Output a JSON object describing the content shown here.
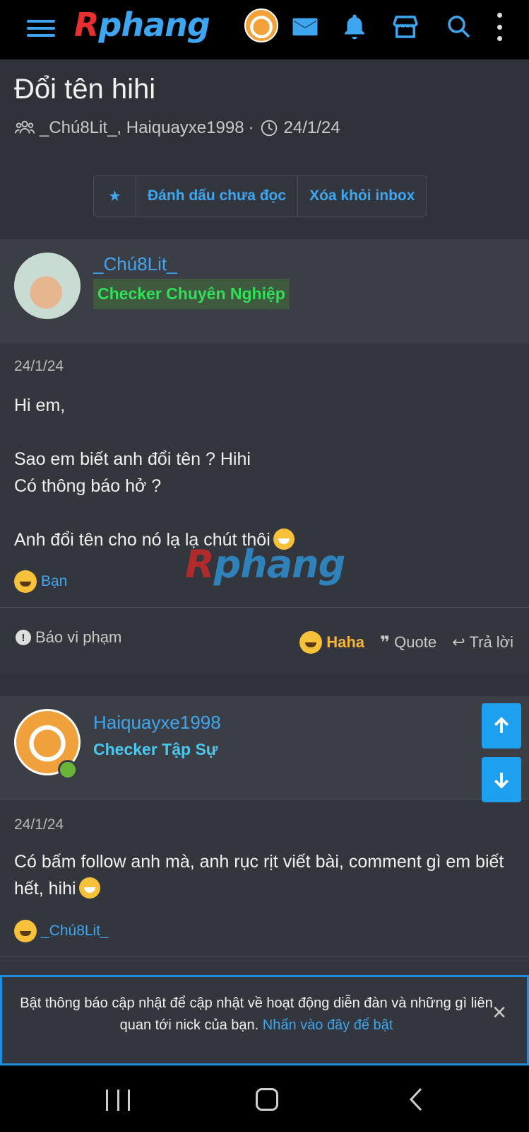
{
  "topbar": {
    "logo_part1": "R",
    "logo_part2": "phang",
    "icons": [
      "menu-icon",
      "avatar",
      "mail-icon",
      "bell-icon",
      "store-icon",
      "search-icon",
      "kebab-menu-icon"
    ]
  },
  "thread": {
    "title": "Đổi tên hihi",
    "participants": "_Chú8Lit_, Haiquayxe1998",
    "separator": "·",
    "date": "24/1/24",
    "actions": {
      "star": "★",
      "mark_unread": "Đánh dấu chưa đọc",
      "remove_inbox": "Xóa khỏi inbox"
    }
  },
  "posts": [
    {
      "username": "_Chú8Lit_",
      "rank": "Checker Chuyên Nghiệp",
      "date": "24/1/24",
      "lines": [
        "Hi em,",
        "",
        "Sao em biết anh đổi tên ? Hihi",
        "Có thông báo hở ?",
        "",
        "Anh đổi tên cho nó lạ lạ chút thôi"
      ],
      "reaction_by": "Bạn",
      "footer": {
        "report": "Báo vi phạm",
        "haha": "Haha",
        "quote": "Quote",
        "reply": "Trả lời"
      }
    },
    {
      "username": "Haiquayxe1998",
      "rank": "Checker Tập Sự",
      "date": "24/1/24",
      "text": "Có bấm follow anh mà, anh rục rịt viết bài, comment gì em biết hết, hihi",
      "reaction_by": "_Chú8Lit_"
    }
  ],
  "watermark": {
    "part1": "R",
    "part2": "phang"
  },
  "notice": {
    "text": "Bật thông báo cập nhật để cập nhật về hoạt động diễn đàn và những gì liên quan tới nick của bạn.",
    "link": "Nhấn vào đây để bật",
    "close": "×"
  },
  "colors": {
    "accent": "#3ea6f0",
    "background": "#2f3238",
    "rank_green": "#2ee05a",
    "rank_blue": "#4ac8f0",
    "haha": "#f6b53a"
  }
}
